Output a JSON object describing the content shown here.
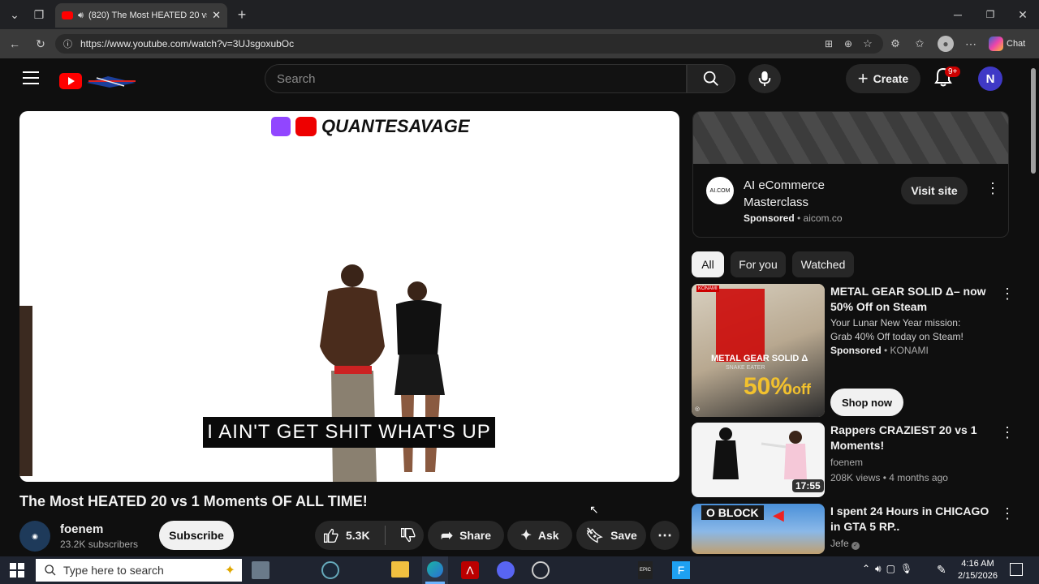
{
  "browser": {
    "tab_title": "(820) The Most HEATED 20 vs",
    "url": "https://www.youtube.com/watch?v=3UJsgoxubOc",
    "chat_label": "Chat"
  },
  "header": {
    "search_placeholder": "Search",
    "create_label": "Create",
    "notif_badge": "9+",
    "avatar_letter": "N"
  },
  "video": {
    "watermark": "QUANTESAVAGE",
    "caption": "I AIN'T GET SHIT WHAT'S UP",
    "title": "The Most HEATED 20 vs 1 Moments OF ALL TIME!",
    "channel": "foenem",
    "subscribers": "23.2K subscribers",
    "subscribe_label": "Subscribe",
    "likes": "5.3K",
    "share_label": "Share",
    "ask_label": "Ask",
    "save_label": "Save"
  },
  "ad": {
    "logo_text": "AI.COM",
    "title": "AI eCommerce Masterclass",
    "sponsored": "Sponsored",
    "domain": "aicom.co",
    "cta": "Visit site"
  },
  "chips": [
    "All",
    "For you",
    "Watched"
  ],
  "cards": [
    {
      "title": "METAL GEAR SOLID Δ– now 50% Off on Steam",
      "desc": "Your Lunar New Year mission: Grab 40% Off today on Steam!",
      "sponsored": "Sponsored",
      "advertiser": "KONAMI",
      "cta": "Shop now",
      "thumb_title": "METAL GEAR SOLID Δ",
      "thumb_sub": "SNAKE EATER",
      "thumb_offer": "50%",
      "thumb_off": "off",
      "thumb_brand": "KONAMI"
    },
    {
      "title": "Rappers CRAZIEST 20 vs 1 Moments!",
      "channel": "foenem",
      "meta": "208K views • 4 months ago",
      "duration": "17:55"
    },
    {
      "title": "I spent 24 Hours in CHICAGO in GTA 5 RP..",
      "channel": "Jefe",
      "thumb_text": "O BLOCK"
    }
  ],
  "taskbar": {
    "search_placeholder": "Type here to search",
    "time": "4:16 AM",
    "date": "2/15/2026"
  }
}
